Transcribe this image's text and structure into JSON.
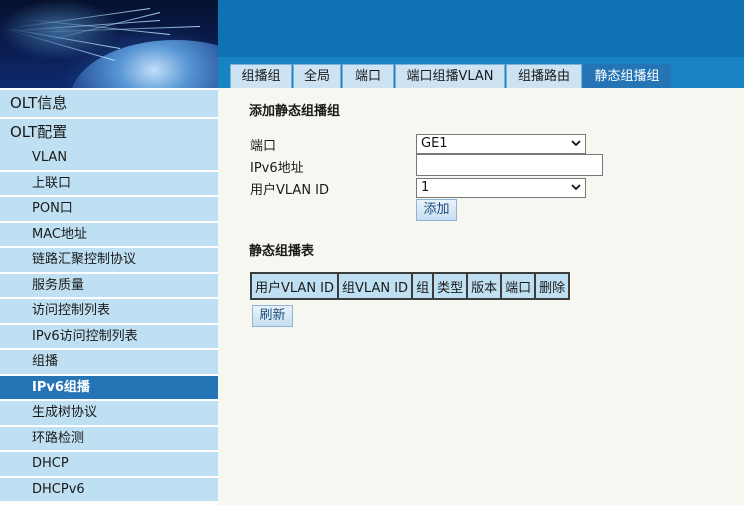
{
  "header": {
    "tabs": [
      {
        "label": "组播组",
        "active": false
      },
      {
        "label": "全局",
        "active": false
      },
      {
        "label": "端口",
        "active": false
      },
      {
        "label": "端口组播VLAN",
        "active": false
      },
      {
        "label": "组播路由",
        "active": false
      },
      {
        "label": "静态组播组",
        "active": true
      }
    ],
    "colors": {
      "topbar": "#0f73b3",
      "tab_active": "#2474b6",
      "tab_inactive": "#cde3f3",
      "sidebar_item": "#bfe0f3"
    }
  },
  "sidebar": {
    "items": [
      {
        "label": "OLT信息",
        "level": 1,
        "active": false
      },
      {
        "label": "OLT配置",
        "level": 1,
        "active": false
      },
      {
        "label": "VLAN",
        "level": 2,
        "active": false
      },
      {
        "label": "上联口",
        "level": 2,
        "active": false
      },
      {
        "label": "PON口",
        "level": 2,
        "active": false
      },
      {
        "label": "MAC地址",
        "level": 2,
        "active": false
      },
      {
        "label": "链路汇聚控制协议",
        "level": 2,
        "active": false
      },
      {
        "label": "服务质量",
        "level": 2,
        "active": false
      },
      {
        "label": "访问控制列表",
        "level": 2,
        "active": false
      },
      {
        "label": "IPv6访问控制列表",
        "level": 2,
        "active": false
      },
      {
        "label": "组播",
        "level": 2,
        "active": false
      },
      {
        "label": "IPv6组播",
        "level": 2,
        "active": true
      },
      {
        "label": "生成树协议",
        "level": 2,
        "active": false
      },
      {
        "label": "环路检测",
        "level": 2,
        "active": false
      },
      {
        "label": "DHCP",
        "level": 2,
        "active": false
      },
      {
        "label": "DHCPv6",
        "level": 2,
        "active": false
      }
    ]
  },
  "form": {
    "title": "添加静态组播组",
    "port_label": "端口",
    "port_value": "GE1",
    "ipv6_label": "IPv6地址",
    "ipv6_value": "",
    "vlan_label": "用户VLAN ID",
    "vlan_value": "1",
    "add_button": "添加"
  },
  "table": {
    "title": "静态组播表",
    "columns": [
      "用户VLAN ID",
      "组VLAN ID",
      "组",
      "类型",
      "版本",
      "端口",
      "删除"
    ],
    "rows": [],
    "refresh_button": "刷新"
  }
}
